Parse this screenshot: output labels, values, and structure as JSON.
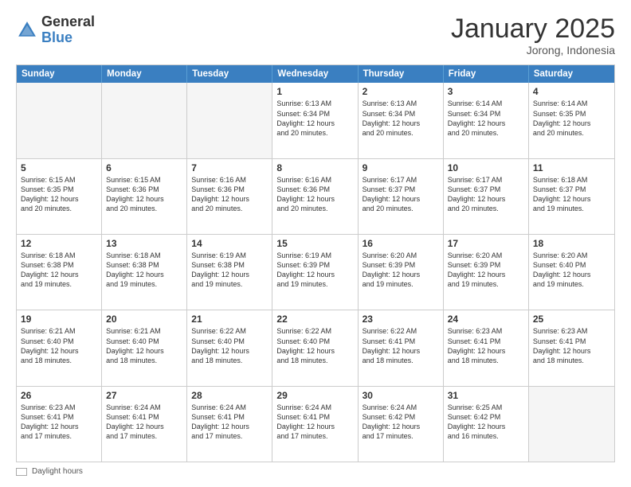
{
  "header": {
    "logo_general": "General",
    "logo_blue": "Blue",
    "title": "January 2025",
    "subtitle": "Jorong, Indonesia"
  },
  "days_of_week": [
    "Sunday",
    "Monday",
    "Tuesday",
    "Wednesday",
    "Thursday",
    "Friday",
    "Saturday"
  ],
  "footer": {
    "label": "Daylight hours"
  },
  "weeks": [
    {
      "cells": [
        {
          "day": "",
          "empty": true
        },
        {
          "day": "",
          "empty": true
        },
        {
          "day": "",
          "empty": true
        },
        {
          "day": "1",
          "lines": [
            "Sunrise: 6:13 AM",
            "Sunset: 6:34 PM",
            "Daylight: 12 hours",
            "and 20 minutes."
          ]
        },
        {
          "day": "2",
          "lines": [
            "Sunrise: 6:13 AM",
            "Sunset: 6:34 PM",
            "Daylight: 12 hours",
            "and 20 minutes."
          ]
        },
        {
          "day": "3",
          "lines": [
            "Sunrise: 6:14 AM",
            "Sunset: 6:34 PM",
            "Daylight: 12 hours",
            "and 20 minutes."
          ]
        },
        {
          "day": "4",
          "lines": [
            "Sunrise: 6:14 AM",
            "Sunset: 6:35 PM",
            "Daylight: 12 hours",
            "and 20 minutes."
          ]
        }
      ]
    },
    {
      "cells": [
        {
          "day": "5",
          "lines": [
            "Sunrise: 6:15 AM",
            "Sunset: 6:35 PM",
            "Daylight: 12 hours",
            "and 20 minutes."
          ]
        },
        {
          "day": "6",
          "lines": [
            "Sunrise: 6:15 AM",
            "Sunset: 6:36 PM",
            "Daylight: 12 hours",
            "and 20 minutes."
          ]
        },
        {
          "day": "7",
          "lines": [
            "Sunrise: 6:16 AM",
            "Sunset: 6:36 PM",
            "Daylight: 12 hours",
            "and 20 minutes."
          ]
        },
        {
          "day": "8",
          "lines": [
            "Sunrise: 6:16 AM",
            "Sunset: 6:36 PM",
            "Daylight: 12 hours",
            "and 20 minutes."
          ]
        },
        {
          "day": "9",
          "lines": [
            "Sunrise: 6:17 AM",
            "Sunset: 6:37 PM",
            "Daylight: 12 hours",
            "and 20 minutes."
          ]
        },
        {
          "day": "10",
          "lines": [
            "Sunrise: 6:17 AM",
            "Sunset: 6:37 PM",
            "Daylight: 12 hours",
            "and 20 minutes."
          ]
        },
        {
          "day": "11",
          "lines": [
            "Sunrise: 6:18 AM",
            "Sunset: 6:37 PM",
            "Daylight: 12 hours",
            "and 19 minutes."
          ]
        }
      ]
    },
    {
      "cells": [
        {
          "day": "12",
          "lines": [
            "Sunrise: 6:18 AM",
            "Sunset: 6:38 PM",
            "Daylight: 12 hours",
            "and 19 minutes."
          ]
        },
        {
          "day": "13",
          "lines": [
            "Sunrise: 6:18 AM",
            "Sunset: 6:38 PM",
            "Daylight: 12 hours",
            "and 19 minutes."
          ]
        },
        {
          "day": "14",
          "lines": [
            "Sunrise: 6:19 AM",
            "Sunset: 6:38 PM",
            "Daylight: 12 hours",
            "and 19 minutes."
          ]
        },
        {
          "day": "15",
          "lines": [
            "Sunrise: 6:19 AM",
            "Sunset: 6:39 PM",
            "Daylight: 12 hours",
            "and 19 minutes."
          ]
        },
        {
          "day": "16",
          "lines": [
            "Sunrise: 6:20 AM",
            "Sunset: 6:39 PM",
            "Daylight: 12 hours",
            "and 19 minutes."
          ]
        },
        {
          "day": "17",
          "lines": [
            "Sunrise: 6:20 AM",
            "Sunset: 6:39 PM",
            "Daylight: 12 hours",
            "and 19 minutes."
          ]
        },
        {
          "day": "18",
          "lines": [
            "Sunrise: 6:20 AM",
            "Sunset: 6:40 PM",
            "Daylight: 12 hours",
            "and 19 minutes."
          ]
        }
      ]
    },
    {
      "cells": [
        {
          "day": "19",
          "lines": [
            "Sunrise: 6:21 AM",
            "Sunset: 6:40 PM",
            "Daylight: 12 hours",
            "and 18 minutes."
          ]
        },
        {
          "day": "20",
          "lines": [
            "Sunrise: 6:21 AM",
            "Sunset: 6:40 PM",
            "Daylight: 12 hours",
            "and 18 minutes."
          ]
        },
        {
          "day": "21",
          "lines": [
            "Sunrise: 6:22 AM",
            "Sunset: 6:40 PM",
            "Daylight: 12 hours",
            "and 18 minutes."
          ]
        },
        {
          "day": "22",
          "lines": [
            "Sunrise: 6:22 AM",
            "Sunset: 6:40 PM",
            "Daylight: 12 hours",
            "and 18 minutes."
          ]
        },
        {
          "day": "23",
          "lines": [
            "Sunrise: 6:22 AM",
            "Sunset: 6:41 PM",
            "Daylight: 12 hours",
            "and 18 minutes."
          ]
        },
        {
          "day": "24",
          "lines": [
            "Sunrise: 6:23 AM",
            "Sunset: 6:41 PM",
            "Daylight: 12 hours",
            "and 18 minutes."
          ]
        },
        {
          "day": "25",
          "lines": [
            "Sunrise: 6:23 AM",
            "Sunset: 6:41 PM",
            "Daylight: 12 hours",
            "and 18 minutes."
          ]
        }
      ]
    },
    {
      "cells": [
        {
          "day": "26",
          "lines": [
            "Sunrise: 6:23 AM",
            "Sunset: 6:41 PM",
            "Daylight: 12 hours",
            "and 17 minutes."
          ]
        },
        {
          "day": "27",
          "lines": [
            "Sunrise: 6:24 AM",
            "Sunset: 6:41 PM",
            "Daylight: 12 hours",
            "and 17 minutes."
          ]
        },
        {
          "day": "28",
          "lines": [
            "Sunrise: 6:24 AM",
            "Sunset: 6:41 PM",
            "Daylight: 12 hours",
            "and 17 minutes."
          ]
        },
        {
          "day": "29",
          "lines": [
            "Sunrise: 6:24 AM",
            "Sunset: 6:41 PM",
            "Daylight: 12 hours",
            "and 17 minutes."
          ]
        },
        {
          "day": "30",
          "lines": [
            "Sunrise: 6:24 AM",
            "Sunset: 6:42 PM",
            "Daylight: 12 hours",
            "and 17 minutes."
          ]
        },
        {
          "day": "31",
          "lines": [
            "Sunrise: 6:25 AM",
            "Sunset: 6:42 PM",
            "Daylight: 12 hours",
            "and 16 minutes."
          ]
        },
        {
          "day": "",
          "empty": true
        }
      ]
    }
  ]
}
